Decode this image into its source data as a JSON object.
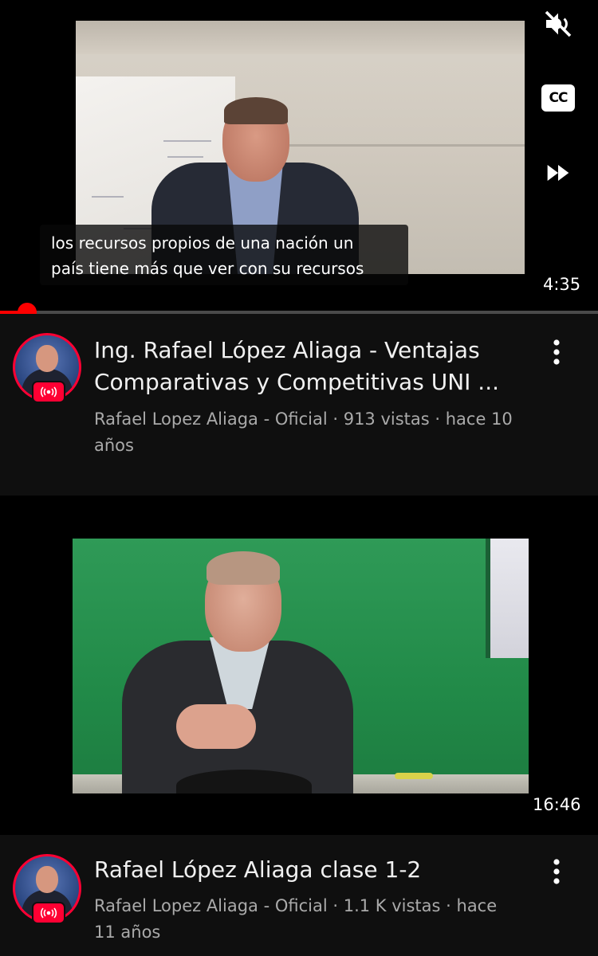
{
  "video1": {
    "caption_line1": "los recursos propios de una nación un",
    "caption_line2": "país tiene más que ver con su recursos",
    "duration": "4:35",
    "progress_fraction": 0.045,
    "controls": [
      "mute-icon",
      "closed-captions-icon",
      "fast-forward-icon"
    ],
    "cc_label": "CC",
    "title": "Ing. Rafael López Aliaga - Ventajas Comparativas y Competitivas UNI ...",
    "title_line1": "Ing. Rafael López Aliaga - Ventajas",
    "title_line2": "Comparativas y Competitivas UNI ...",
    "meta_line1": "Rafael Lopez Aliaga - Oficial · 913 vistas · hace 10",
    "meta_line2": "años",
    "live_badge_icon": "live-broadcast-icon"
  },
  "video2": {
    "duration": "16:46",
    "title": "Rafael López Aliaga clase 1-2",
    "meta_line1": "Rafael Lopez Aliaga - Oficial · 1.1 K vistas · hace",
    "meta_line2": "11 años",
    "live_badge_icon": "live-broadcast-icon"
  },
  "colors": {
    "background": "#0f0f0f",
    "accent": "#ff0000",
    "meta_text": "#aaaaaa"
  }
}
